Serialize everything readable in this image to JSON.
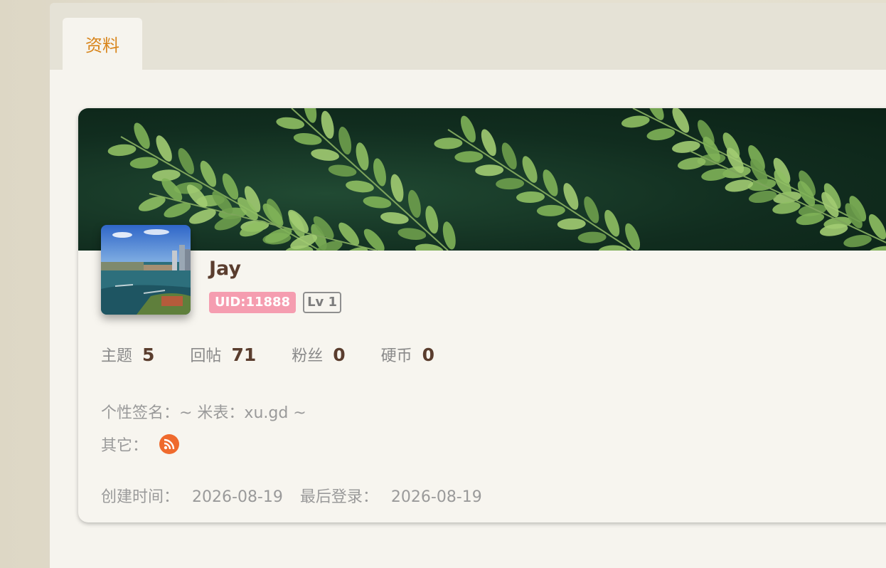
{
  "tabs": [
    {
      "label": "资料",
      "active": true
    }
  ],
  "profile": {
    "username": "Jay",
    "uid": "UID:11888",
    "level": "Lv 1",
    "stats": [
      {
        "label": "主题",
        "value": "5"
      },
      {
        "label": "回帖",
        "value": "71"
      },
      {
        "label": "粉丝",
        "value": "0"
      },
      {
        "label": "硬币",
        "value": "0"
      }
    ],
    "signature": "个性签名：~ 米表：xu.gd ~",
    "other_label": "其它：",
    "other_icon": "rss-icon",
    "created_label": "创建时间：",
    "created_value": "2026-08-19",
    "last_login_label": "最后登录：",
    "last_login_value": "2026-08-19"
  },
  "colors": {
    "accent_tab": "#d8851c",
    "uid_badge": "#f59db0",
    "rss": "#ef6a2d",
    "stat_value": "#5a3d2e"
  }
}
